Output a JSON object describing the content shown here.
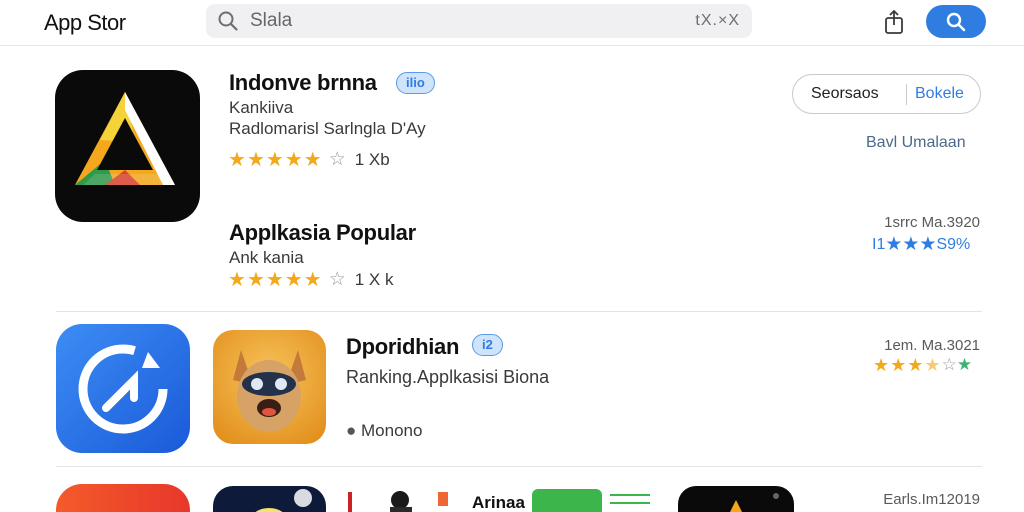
{
  "header": {
    "title": "App Stor",
    "search_placeholder": "Slala",
    "clear_label": "tX.×X"
  },
  "featured": {
    "title": "Indonve brnna",
    "badge": "ilio",
    "category": "Kankiiva",
    "subtitle": "Radlomarisl Sarlngla D'Ay",
    "rating_count": "1 Xb",
    "action_primary": "Seorsaos",
    "action_secondary": "Bokele",
    "developer_link": "Bavl Umalaan"
  },
  "popular": {
    "title": "Applkasia Popular",
    "category": "Ank kania",
    "rating_count": "1 X k",
    "date": "1srrc Ma.3920",
    "rating_label": "I1",
    "rating_percent": "S9%"
  },
  "ranking": {
    "title": "Dporidhian",
    "badge": "i2",
    "subtitle": "Ranking.Applkasisi Biona",
    "meta": "Monono",
    "date": "1em. Ma.3021"
  },
  "bottom_row": {
    "label": "Arinaa",
    "date": "Earls.Im12019"
  },
  "colors": {
    "accent": "#2f7de1",
    "star": "#f2a91c"
  }
}
